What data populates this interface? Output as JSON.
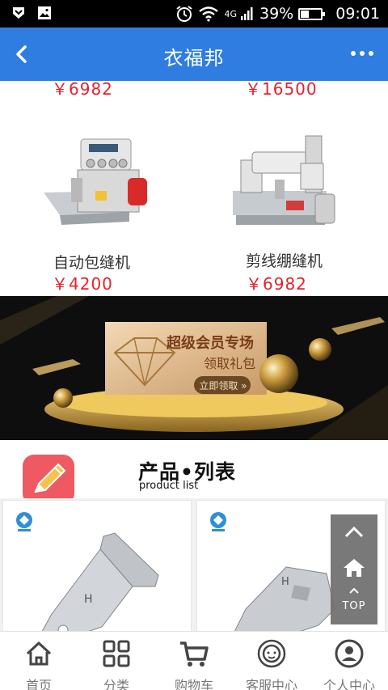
{
  "status_bar": {
    "signal_label": "4G",
    "battery_percent": "39%",
    "battery_level": 0.39,
    "time": "09:01",
    "icons": [
      "notification-icon",
      "image-icon",
      "alarm-icon",
      "wifi-icon",
      "cell-signal-icon",
      "battery-icon"
    ]
  },
  "header": {
    "title": "衣福邦",
    "back_icon": "chevron-left-icon",
    "more_icon": "more-dots-icon"
  },
  "products_top": {
    "row1": [
      {
        "price": "￥6982"
      },
      {
        "price": "￥16500"
      }
    ],
    "row2": [
      {
        "name": "自动包缝机",
        "price": "￥4200"
      },
      {
        "name": "剪线绷缝机",
        "price": "￥6982"
      }
    ]
  },
  "banner": {
    "headline": "超级会员专场",
    "subline": "领取礼包",
    "button": "立即领取"
  },
  "section": {
    "title": "产品•列表",
    "subtitle": "product list",
    "badge_icon": "pencil-icon"
  },
  "float_nav": {
    "up_icon": "chevron-up-icon",
    "home_icon": "home-icon",
    "top_label": "TOP"
  },
  "tabbar": {
    "items": [
      {
        "label": "首页",
        "icon": "home-outline-icon"
      },
      {
        "label": "分类",
        "icon": "grid-icon"
      },
      {
        "label": "购物车",
        "icon": "cart-icon"
      },
      {
        "label": "客服中心",
        "icon": "customer-service-icon"
      },
      {
        "label": "个人中心",
        "icon": "user-icon"
      }
    ]
  },
  "colors": {
    "header_blue": "#2f7de1",
    "price_red": "#e8202b",
    "badge_red": "#ef5a62"
  }
}
